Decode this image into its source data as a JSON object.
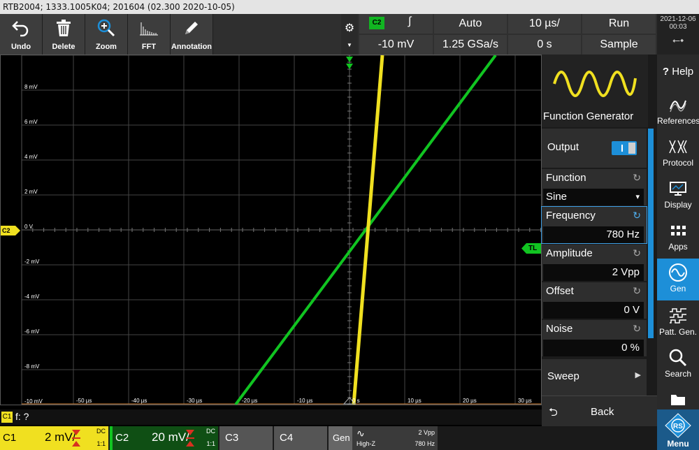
{
  "titlebar": {
    "text": "RTB2004; 1333.1005K04; 201604 (02.300 2020-10-05)"
  },
  "toolbar": {
    "tools": [
      {
        "label": "Undo",
        "icon": "undo-icon"
      },
      {
        "label": "Delete",
        "icon": "trash-icon"
      },
      {
        "label": "Zoom",
        "icon": "zoom-icon"
      },
      {
        "label": "FFT",
        "icon": "fft-icon"
      },
      {
        "label": "Annotation",
        "icon": "pen-icon"
      }
    ]
  },
  "acquisition": {
    "trigger_source": "C2",
    "trigger_level": "-10 mV",
    "trigger_mode": "Auto",
    "sample_rate": "1.25 GSa/s",
    "timebase": "10 µs/",
    "position": "0 s",
    "run_state": "Run",
    "acq_mode": "Sample"
  },
  "datetime": {
    "date": "2021-12-06",
    "time": "00:03"
  },
  "plot": {
    "y_labels": [
      "8 mV",
      "6 mV",
      "4 mV",
      "2 mV",
      "0 V",
      "-2 mV",
      "-4 mV",
      "-6 mV",
      "-8 mV",
      "-10 mV"
    ],
    "x_labels": [
      "-50 µs",
      "-40 µs",
      "-30 µs",
      "-20 µs",
      "-10 µs",
      "0 s",
      "10 µs",
      "20 µs",
      "30 µs"
    ],
    "c2_marker": "C2",
    "tl_marker": "TL",
    "colors": {
      "c1": "#f0e020",
      "c2": "#11c421",
      "grid": "#444444"
    }
  },
  "panel": {
    "title": "Function Generator",
    "output_label": "Output",
    "function_label": "Function",
    "function_value": "Sine",
    "frequency_label": "Frequency",
    "frequency_value": "780 Hz",
    "amplitude_label": "Amplitude",
    "amplitude_value": "2 Vpp",
    "offset_label": "Offset",
    "offset_value": "0 V",
    "noise_label": "Noise",
    "noise_value": "0 %",
    "sweep_label": "Sweep",
    "back_label": "Back"
  },
  "sidemenu": {
    "items": [
      "Help",
      "References",
      "Protocol",
      "Display",
      "Apps",
      "Gen",
      "Patt. Gen.",
      "Search"
    ],
    "menu_label": "Menu"
  },
  "formulabar": {
    "channel": "C1",
    "text": "f: ?"
  },
  "channels": {
    "c1": {
      "name": "C1",
      "scale": "2 mV/",
      "coupling": "DC",
      "ratio": "1:1"
    },
    "c2": {
      "name": "C2",
      "scale": "20 mV/",
      "coupling": "DC",
      "ratio": "1:1"
    },
    "c3": {
      "name": "C3"
    },
    "c4": {
      "name": "C4"
    },
    "gen": {
      "name": "Gen",
      "load": "High-Z",
      "amp": "2 Vpp",
      "freq": "780 Hz"
    }
  }
}
